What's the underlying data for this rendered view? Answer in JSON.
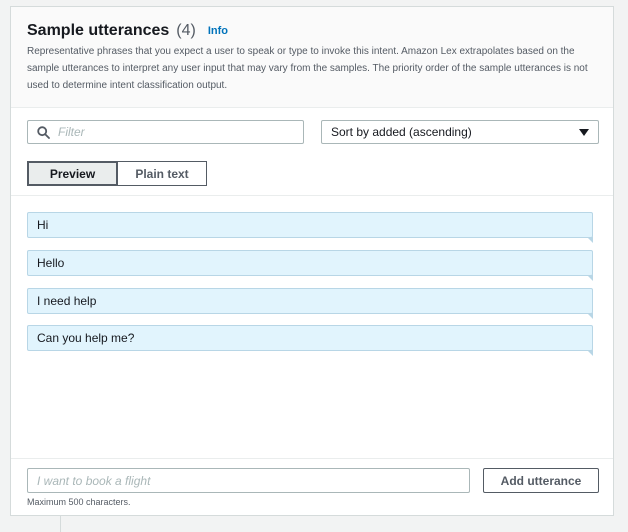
{
  "header": {
    "title": "Sample utterances",
    "count": "(4)",
    "info_link": "Info",
    "description": "Representative phrases that you expect a user to speak or type to invoke this intent. Amazon Lex extrapolates based on the sample utterances to interpret any user input that may vary from the samples. The priority order of the sample utterances is not used to determine intent classification output."
  },
  "filter": {
    "placeholder": "Filter",
    "icon": "search-icon"
  },
  "sort": {
    "selected": "Sort by added (ascending)",
    "icon": "caret-down-icon"
  },
  "view_toggle": {
    "preview_label": "Preview",
    "plain_text_label": "Plain text",
    "selected": "Preview"
  },
  "utterances": [
    "Hi",
    "Hello",
    "I need help",
    "Can you help me?"
  ],
  "add": {
    "placeholder": "I want to book a flight",
    "button_label": "Add utterance",
    "hint": "Maximum 500 characters."
  },
  "colors": {
    "link": "#0073bb",
    "utterance_bg": "#e1f4fd",
    "utterance_border": "#b8d6e6",
    "page_bg": "#f2f3f3"
  }
}
